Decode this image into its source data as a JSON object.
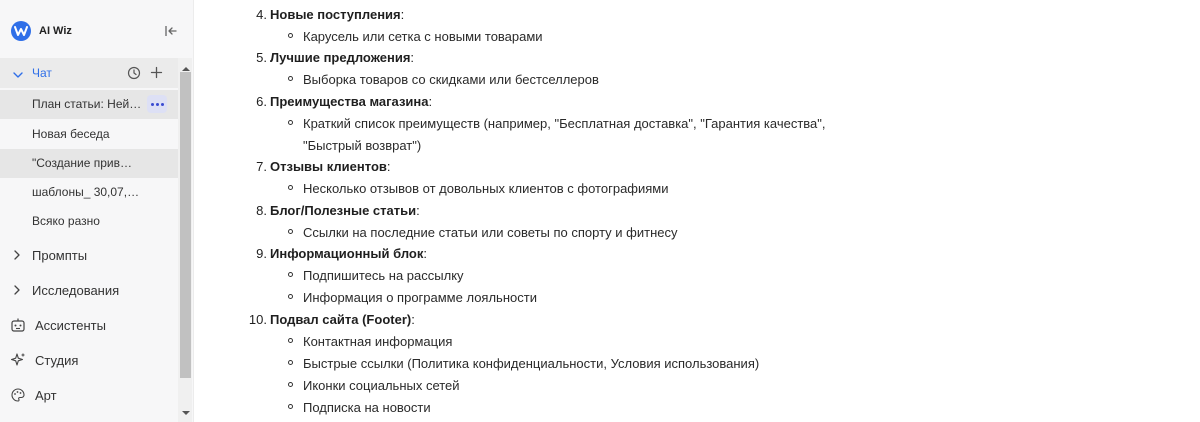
{
  "app": {
    "name": "AI Wiz",
    "accent": "#2f6fe8"
  },
  "sidebar": {
    "chat_label": "Чат",
    "chats": [
      "План статьи: Ней…",
      "Новая беседа",
      "\"Создание прив…",
      "шаблоны_ 30,07,…",
      "Всяко разно"
    ],
    "sections": [
      {
        "label": "Промпты",
        "icon": "chevron-right-icon"
      },
      {
        "label": "Исследования",
        "icon": "chevron-right-icon"
      },
      {
        "label": "Ассистенты",
        "icon": "robot-icon"
      },
      {
        "label": "Студия",
        "icon": "sparkle-icon"
      },
      {
        "label": "Арт",
        "icon": "palette-icon"
      }
    ]
  },
  "content": {
    "items": [
      {
        "num": "4.",
        "title": "Новые поступления",
        "bullets": [
          "Карусель или сетка с новыми товарами"
        ]
      },
      {
        "num": "5.",
        "title": "Лучшие предложения",
        "bullets": [
          "Выборка товаров со скидками или бестселлеров"
        ]
      },
      {
        "num": "6.",
        "title": "Преимущества магазина",
        "bullets": [
          "Краткий список преимуществ (например, \"Бесплатная доставка\", \"Гарантия качества\",",
          "\"Быстрый возврат\")"
        ]
      },
      {
        "num": "7.",
        "title": "Отзывы клиентов",
        "bullets": [
          "Несколько отзывов от довольных клиентов с фотографиями"
        ]
      },
      {
        "num": "8.",
        "title": "Блог/Полезные статьи",
        "bullets": [
          "Ссылки на последние статьи или советы по спорту и фитнесу"
        ]
      },
      {
        "num": "9.",
        "title": "Информационный блок",
        "bullets": [
          "Подпишитесь на рассылку",
          "Информация о программе лояльности"
        ]
      },
      {
        "num": "10.",
        "title": "Подвал сайта (Footer)",
        "bullets": [
          "Контактная информация",
          "Быстрые ссылки (Политика конфиденциальности, Условия использования)",
          "Иконки социальных сетей",
          "Подписка на новости"
        ]
      }
    ]
  }
}
